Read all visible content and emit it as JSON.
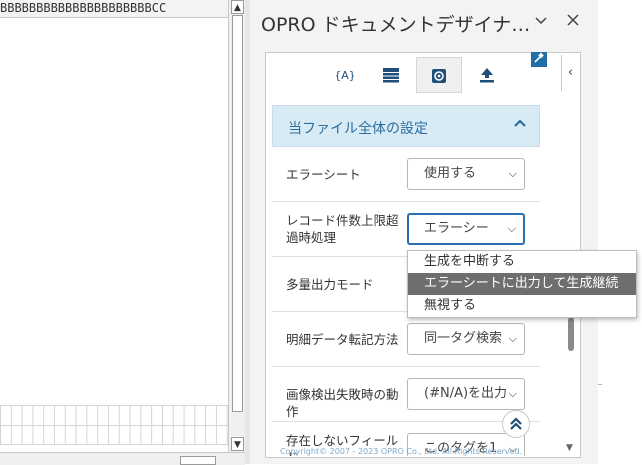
{
  "sheet": {
    "column_strip_text": "BBBBBBBBBBBBBBBBBBBBBCC"
  },
  "pane": {
    "title": "OPRO ドキュメントデザイナ…",
    "collapse_glyph": "‹",
    "icons": [
      "variable-icon",
      "table-icon",
      "settings-icon",
      "upload-icon",
      "pin-icon"
    ],
    "section": {
      "title": "当ファイル全体の設定",
      "rows": [
        {
          "label": "エラーシート",
          "value": "使用する"
        },
        {
          "label": "レコード件数上限超過時処理",
          "value": "エラーシー"
        },
        {
          "label": "多量出力モード",
          "value": ""
        },
        {
          "label": "明細データ転記方法",
          "value": "同一タグ検索"
        },
        {
          "label": "画像検出失敗時の動作",
          "value": "(#N/A)を出力"
        },
        {
          "label": "存在しないフィールド",
          "value": "このタグを1"
        }
      ]
    },
    "dropdown_options": [
      "生成を中断する",
      "エラーシートに出力して生成継続",
      "無視する"
    ],
    "highlighted_option": 1,
    "copyright": "Copyright© 2007 - 2023 OPRO Co., Ltd. All Rights Reserved."
  },
  "colors": {
    "accent": "#2c6f9e",
    "section_bg": "#d8ebf5",
    "focus_border": "#2a6fb3",
    "highlight": "#6e6e6e"
  }
}
